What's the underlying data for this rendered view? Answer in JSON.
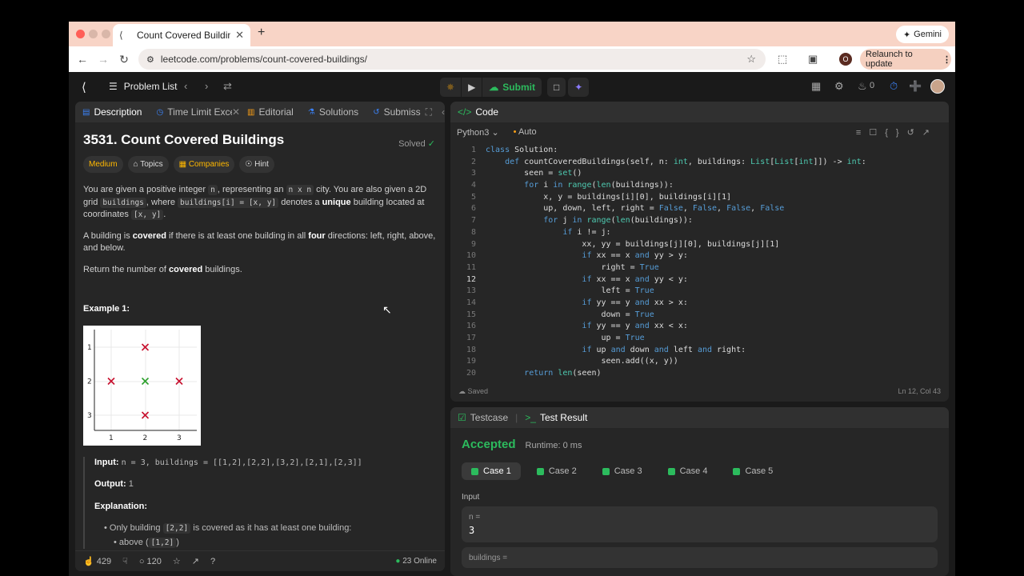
{
  "browser": {
    "tab_title": "Count Covered Buildings - Le",
    "url": "leetcode.com/problems/count-covered-buildings/",
    "gemini_label": "Gemini",
    "profile_letter": "O",
    "relaunch_label": "Relaunch to update"
  },
  "nav": {
    "problem_list": "Problem List",
    "submit": "Submit",
    "streak": "0"
  },
  "left_tabs": [
    {
      "label": "Description"
    },
    {
      "label": "Time Limit Exceede"
    },
    {
      "label": "Editorial"
    },
    {
      "label": "Solutions"
    },
    {
      "label": "Submiss"
    }
  ],
  "problem": {
    "title": "3531. Count Covered Buildings",
    "solved": "Solved",
    "tags": [
      "Medium",
      "Topics",
      "Companies",
      "Hint"
    ],
    "p1_a": "You are given a positive integer ",
    "p1_code1": "n",
    "p1_b": ", representing an ",
    "p1_code2": "n x n",
    "p1_c": " city. You are also given a 2D grid ",
    "p1_code3": "buildings",
    "p1_d": ", where ",
    "p1_code4": "buildings[i] = [x, y]",
    "p1_e": " denotes a ",
    "p1_bold": "unique",
    "p1_f": " building located at coordinates ",
    "p1_code5": "[x, y]",
    "p1_g": ".",
    "p2_a": "A building is ",
    "p2_b1": "covered",
    "p2_b": " if there is at least one building in all ",
    "p2_b2": "four",
    "p2_c": " directions: left, right, above, and below.",
    "p3_a": "Return the number of ",
    "p3_b": "covered",
    "p3_c": " buildings.",
    "example_title": "Example 1:",
    "input_label": "Input:",
    "input_value": "n = 3, buildings = [[1,2],[2,2],[3,2],[2,1],[2,3]]",
    "output_label": "Output:",
    "output_value": "1",
    "explanation_label": "Explanation:",
    "bullet1_a": "Only building ",
    "bullet1_code": "[2,2]",
    "bullet1_b": " is covered as it has at least one building:",
    "bullet2_a": "above (",
    "bullet2_code": "[1,2]",
    "bullet2_b": ")",
    "likes": "429",
    "comments": "120",
    "online": "23 Online"
  },
  "figure": {
    "x_ticks": [
      "1",
      "2",
      "3"
    ],
    "y_ticks": [
      "1",
      "2",
      "3"
    ],
    "colors": {
      "uncovered": "#c8102e",
      "covered": "#2ca02c"
    }
  },
  "editor": {
    "title": "Code",
    "language": "Python3",
    "mode": "Auto",
    "saved": "Saved",
    "cursor": "Ln 12, Col 43",
    "lines": [
      "class Solution:",
      "    def countCoveredBuildings(self, n: int, buildings: List[List[int]]) -> int:",
      "        seen = set()",
      "        for i in range(len(buildings)):",
      "            x, y = buildings[i][0], buildings[i][1]",
      "            up, down, left, right = False, False, False, False",
      "            for j in range(len(buildings)):",
      "                if i != j:",
      "                    xx, yy = buildings[j][0], buildings[j][1]",
      "                    if xx == x and yy > y:",
      "                        right = True",
      "                    if xx == x and yy < y:",
      "                        left = True",
      "                    if yy == y and xx > x:",
      "                        down = True",
      "                    if yy == y and xx < x:",
      "                        up = True",
      "                    if up and down and left and right:",
      "                        seen.add((x, y))",
      "        return len(seen)"
    ]
  },
  "result": {
    "tab_testcase": "Testcase",
    "tab_result": "Test Result",
    "status": "Accepted",
    "runtime": "Runtime: 0 ms",
    "cases": [
      "Case 1",
      "Case 2",
      "Case 3",
      "Case 4",
      "Case 5"
    ],
    "input_label": "Input",
    "n_label": "n =",
    "n_value": "3",
    "buildings_label": "buildings ="
  }
}
